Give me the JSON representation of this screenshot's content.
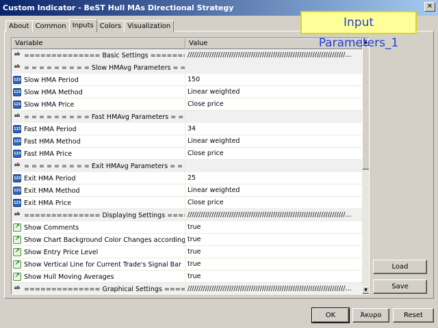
{
  "window": {
    "title": "Custom Indicator - BeST Hull MAs Directional Strategy",
    "close_glyph": "✕"
  },
  "tabs": [
    "About",
    "Common",
    "Inputs",
    "Colors",
    "Visualization"
  ],
  "callout": "Input Parameters_1",
  "grid": {
    "headers": {
      "variable": "Variable",
      "value": "Value"
    },
    "rows": [
      {
        "type": "string",
        "heading": true,
        "name": "============== Basic Settings ==========================...",
        "value": "////////////////////////////////////////////////////////////////////////..."
      },
      {
        "type": "string",
        "heading": true,
        "name": "= = = = = = = = =  Slow HMAvg Parameters  = = = = = = = = =",
        "value": ""
      },
      {
        "type": "int",
        "heading": false,
        "name": "Slow HMA Period",
        "value": "150"
      },
      {
        "type": "int",
        "heading": false,
        "name": "Slow HMA Method",
        "value": "Linear weighted"
      },
      {
        "type": "int",
        "heading": false,
        "name": "Slow HMA Price",
        "value": "Close price"
      },
      {
        "type": "string",
        "heading": true,
        "name": "= = = = = = = = =  Fast HMAvg Parameters  = = = = = = = = =",
        "value": ""
      },
      {
        "type": "int",
        "heading": false,
        "name": "Fast HMA Period",
        "value": "34"
      },
      {
        "type": "int",
        "heading": false,
        "name": "Fast HMA Method",
        "value": "Linear weighted"
      },
      {
        "type": "int",
        "heading": false,
        "name": "Fast HMA Price",
        "value": "Close price"
      },
      {
        "type": "string",
        "heading": true,
        "name": "= = = = = = = = =  Exit HMAvg Parameters  = = = = = = = = =",
        "value": ""
      },
      {
        "type": "int",
        "heading": false,
        "name": "Exit HMA Period",
        "value": "25"
      },
      {
        "type": "int",
        "heading": false,
        "name": "Exit HMA Method",
        "value": "Linear weighted"
      },
      {
        "type": "int",
        "heading": false,
        "name": "Exit HMA Price",
        "value": "Close price"
      },
      {
        "type": "string",
        "heading": true,
        "name": "============== Displaying Settings ======================...",
        "value": "////////////////////////////////////////////////////////////////////////..."
      },
      {
        "type": "bool",
        "heading": false,
        "name": "Show Comments",
        "value": "true"
      },
      {
        "type": "bool",
        "heading": false,
        "name": "Show Chart Background Color Changes according to Trade Type",
        "value": "true"
      },
      {
        "type": "bool",
        "heading": false,
        "name": "Show Entry Price Level",
        "value": "true"
      },
      {
        "type": "bool",
        "heading": false,
        "name": "Show Vertical Line for Current Trade's Signal Bar",
        "value": "true"
      },
      {
        "type": "bool",
        "heading": false,
        "name": "Show Hull Moving Averages",
        "value": "true"
      },
      {
        "type": "string",
        "heading": true,
        "name": "============== Graphical Settings ======================...",
        "value": "////////////////////////////////////////////////////////////////////////..."
      }
    ]
  },
  "icons": {
    "string": "ab",
    "int": "123",
    "bool": "↗"
  },
  "buttons": {
    "load": "Load",
    "save": "Save",
    "ok": "OK",
    "cancel": "Άκυρο",
    "reset": "Reset"
  },
  "scrollbar": {
    "up": "▲",
    "down": "▼"
  }
}
